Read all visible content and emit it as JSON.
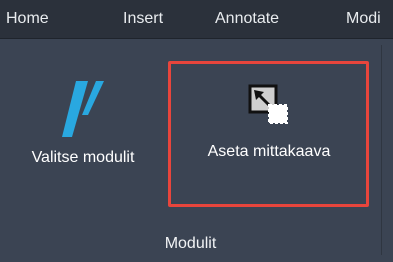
{
  "ribbon_tabs": [
    "Home",
    "Insert",
    "Annotate",
    "Modi"
  ],
  "tools": {
    "select_modules": {
      "label": "Valitse modulit",
      "icon": "double-slash-logo-icon",
      "icon_color": "#29a8e0"
    },
    "set_scale": {
      "label": "Aseta mittakaava",
      "icon": "scale-cursor-box-icon"
    }
  },
  "panel": {
    "title": "Modulit"
  },
  "colors": {
    "tab_bar": "#2b313b",
    "ribbon_background": "#3b4453",
    "highlight_border": "#e8453c",
    "text": "#ffffff"
  }
}
